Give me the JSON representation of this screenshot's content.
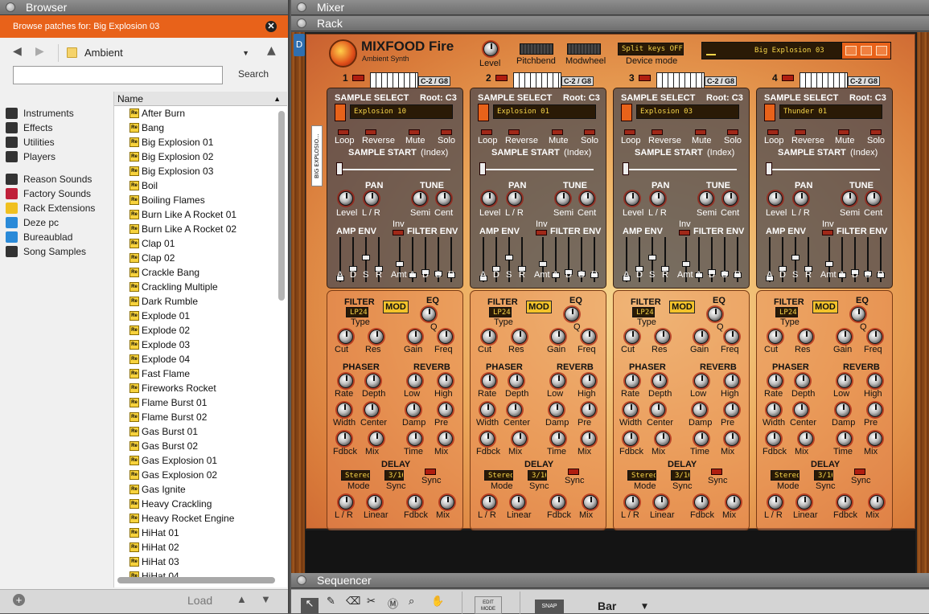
{
  "browser": {
    "title": "Browser",
    "browse_patches_label": "Browse patches for:",
    "browse_patches_target": "Big Explosion 03",
    "location": "Ambient",
    "search_label": "Search",
    "column_name": "Name",
    "load_label": "Load",
    "sidebar": [
      {
        "label": "Instruments",
        "icon": "instruments-icon",
        "color": "#333333"
      },
      {
        "label": "Effects",
        "icon": "effects-icon",
        "color": "#333333"
      },
      {
        "label": "Utilities",
        "icon": "utilities-icon",
        "color": "#333333"
      },
      {
        "label": "Players",
        "icon": "players-icon",
        "color": "#333333"
      },
      {
        "label": "Reason Sounds",
        "icon": "reason-sounds-icon",
        "color": "#333333"
      },
      {
        "label": "Factory Sounds",
        "icon": "factory-sounds-icon",
        "color": "#c0203a"
      },
      {
        "label": "Rack Extensions",
        "icon": "rack-extensions-icon",
        "color": "#f0c020"
      },
      {
        "label": "Deze pc",
        "icon": "computer-icon",
        "color": "#2a8ad8"
      },
      {
        "label": "Bureaublad",
        "icon": "desktop-icon",
        "color": "#2a8ad8"
      },
      {
        "label": "Song Samples",
        "icon": "song-samples-icon",
        "color": "#333333"
      }
    ],
    "patches": [
      "After Burn",
      "Bang",
      "Big Explosion 01",
      "Big Explosion 02",
      "Big Explosion 03",
      "Boil",
      "Boiling Flames",
      "Burn Like A Rocket 01",
      "Burn Like A Rocket 02",
      "Clap 01",
      "Clap 02",
      "Crackle Bang",
      "Crackling Multiple",
      "Dark Rumble",
      "Explode 01",
      "Explode 02",
      "Explode 03",
      "Explode 04",
      "Fast Flame",
      "Fireworks Rocket",
      "Flame Burst 01",
      "Flame Burst 02",
      "Gas Burst 01",
      "Gas Burst 02",
      "Gas Explosion 01",
      "Gas Explosion 02",
      "Gas Ignite",
      "Heavy Crackling",
      "Heavy Rocket Engine",
      "HiHat 01",
      "HiHat 02",
      "HiHat 03",
      "HiHat 04"
    ],
    "patch_icon_text": "Re"
  },
  "panels": {
    "mixer": "Mixer",
    "rack": "Rack",
    "sequencer": "Sequencer"
  },
  "device": {
    "name": "MIXFOOD Fire",
    "subtitle": "Ambient Synth",
    "side_label": "BIG EXPLOSIO...",
    "level": "Level",
    "pitchbend": "Pitchbend",
    "modwheel": "Modwheel",
    "split_keys": "Split keys OFF",
    "device_mode": "Device mode",
    "patch_name": "Big Explosion 03",
    "accent_color": "#e8621a",
    "lcd_color": "#f6d54a"
  },
  "layers": [
    {
      "num": "1",
      "range": "C-2 / G8",
      "sample": "Explosion 10"
    },
    {
      "num": "2",
      "range": "C-2 / G8",
      "sample": "Explosion 01"
    },
    {
      "num": "3",
      "range": "C-2 / G8",
      "sample": "Explosion 03"
    },
    {
      "num": "4",
      "range": "C-2 / G8",
      "sample": "Thunder 01"
    }
  ],
  "layer_labels": {
    "sample_select": "SAMPLE SELECT",
    "root": "Root: C3",
    "loop": "Loop",
    "reverse": "Reverse",
    "mute": "Mute",
    "solo": "Solo",
    "sample_start": "SAMPLE START",
    "index": "(Index)",
    "pan": "PAN",
    "tune": "TUNE",
    "level": "Level",
    "lr": "L / R",
    "semi": "Semi",
    "cent": "Cent",
    "amp_env": "AMP ENV",
    "filter_env": "FILTER ENV",
    "inv": "Inv",
    "a": "A",
    "d": "D",
    "s": "S",
    "r": "R",
    "amt": "Amt"
  },
  "fx_labels": {
    "filter": "FILTER",
    "filter_type": "LP24",
    "type": "Type",
    "mod": "MOD",
    "eq": "EQ",
    "q": "Q",
    "cut": "Cut",
    "res": "Res",
    "gain": "Gain",
    "freq": "Freq",
    "phaser": "PHASER",
    "reverb": "REVERB",
    "rate": "Rate",
    "depth": "Depth",
    "low": "Low",
    "high": "High",
    "width": "Width",
    "center": "Center",
    "damp": "Damp",
    "pre": "Pre",
    "fdbck": "Fdbck",
    "mix": "Mix",
    "time": "Time",
    "delay": "DELAY",
    "stereo": "Stereo",
    "sync_value": "3/16",
    "sync": "Sync",
    "mode": "Mode",
    "lr": "L / R",
    "linear": "Linear"
  },
  "sequencer_toolbar": {
    "edit_mode": "EDIT MODE",
    "snap": "SNAP",
    "bar": "Bar"
  }
}
